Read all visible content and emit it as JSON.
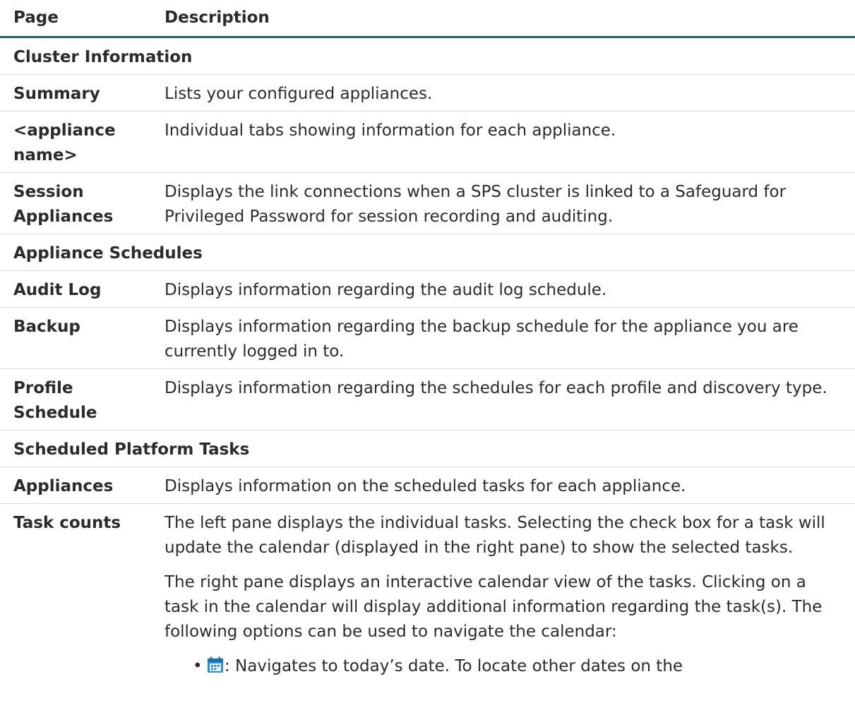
{
  "header": {
    "page": "Page",
    "description": "Description"
  },
  "sections": [
    {
      "title": "Cluster Information",
      "rows": [
        {
          "page": "Summary",
          "description": "Lists your configured appliances."
        },
        {
          "page": "<appliance name>",
          "description": "Individual tabs showing information for each appliance."
        },
        {
          "page": "Session Appliances",
          "description": "Displays the link connections when a SPS cluster is linked to a Safeguard for Privileged Password for session recording and auditing."
        }
      ]
    },
    {
      "title": "Appliance Schedules",
      "rows": [
        {
          "page": "Audit Log",
          "description": "Displays information regarding the audit log schedule."
        },
        {
          "page": "Backup",
          "description": "Displays information regarding the backup schedule for the appliance you are currently logged in to."
        },
        {
          "page": "Profile Schedule",
          "description": "Displays information regarding the schedules for each profile and discovery type."
        }
      ]
    },
    {
      "title": "Scheduled Platform Tasks",
      "rows": [
        {
          "page": "Appliances",
          "description": "Displays information on the scheduled tasks for each appliance."
        }
      ]
    }
  ],
  "task_counts": {
    "page": "Task counts",
    "para1": "The left pane displays the individual tasks. Selecting the check box for a task will update the calendar (displayed in the right pane) to show the selected tasks.",
    "para2": "The right pane displays an interactive calendar view of the tasks. Clicking on a task in the calendar will display additional information regarding the task(s). The following options can be used to navigate the calendar:",
    "options": [
      {
        "icon": "calendar-today-icon",
        "text": ": Navigates to today’s date. To locate other dates on the"
      }
    ]
  },
  "colors": {
    "header_rule": "#1f5f73",
    "icon_blue": "#2a8fd6"
  }
}
